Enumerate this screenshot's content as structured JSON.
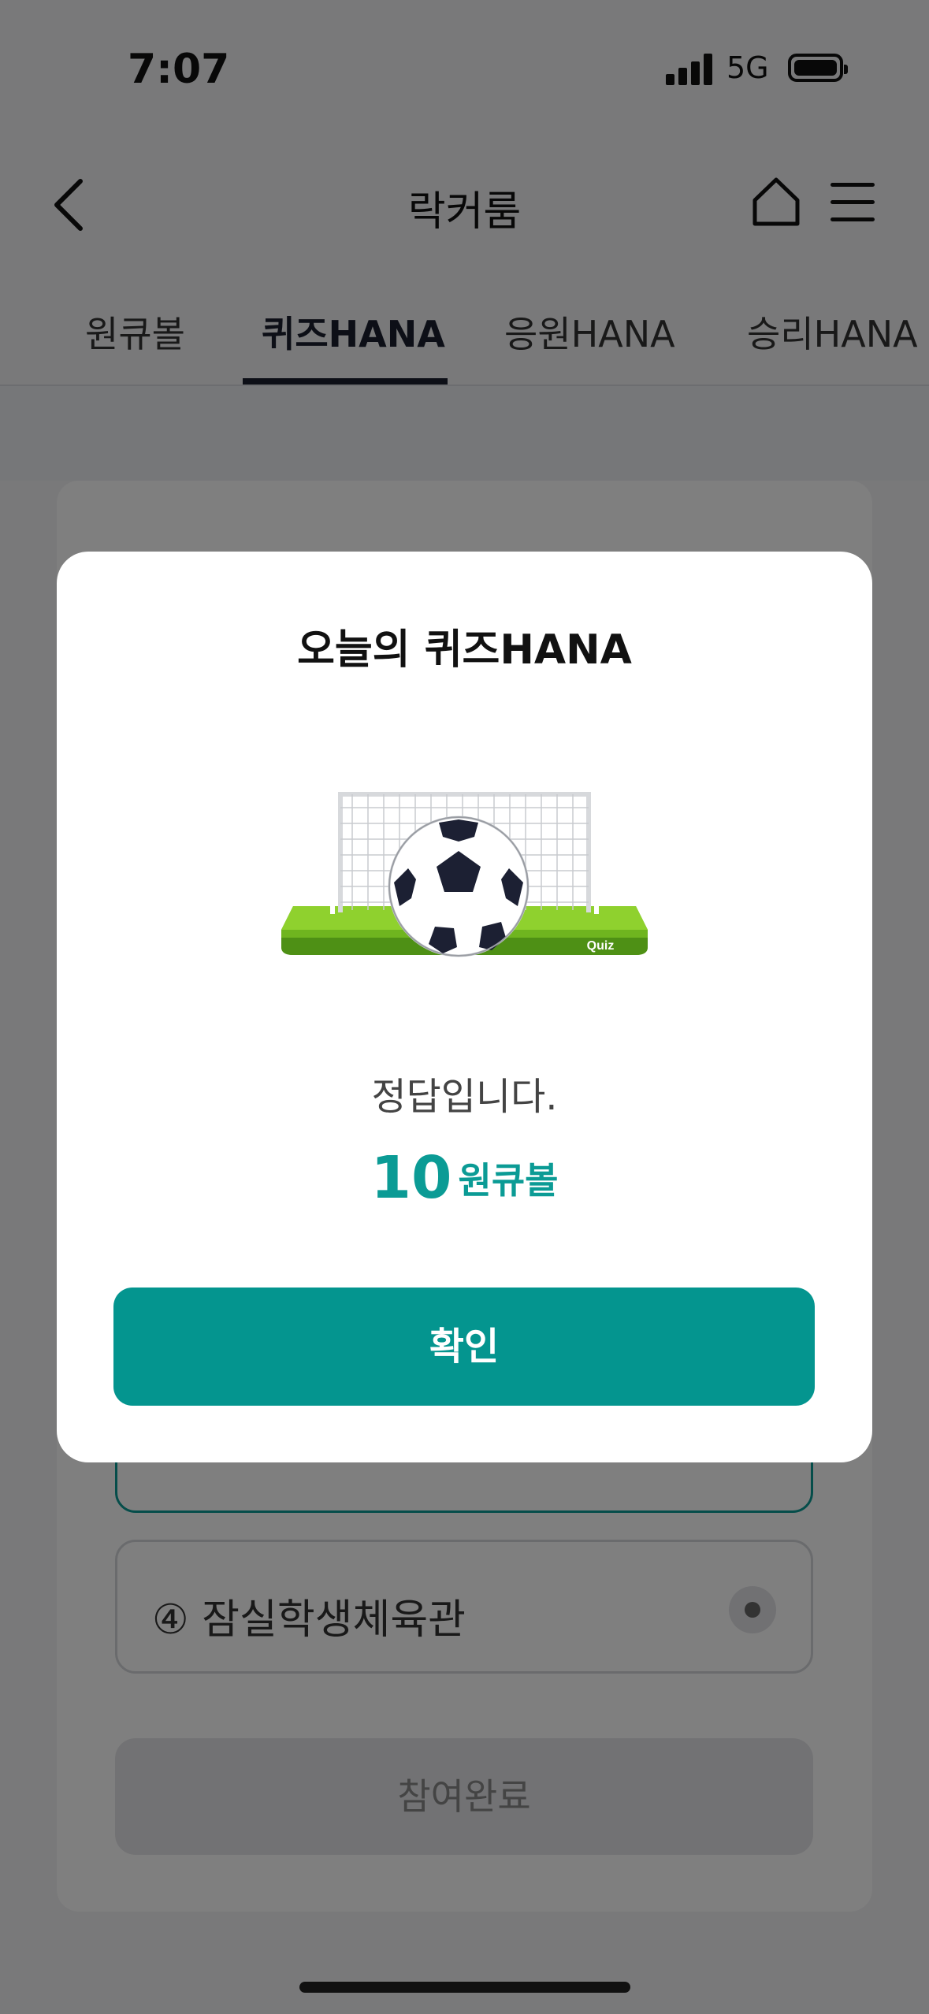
{
  "status_bar": {
    "time": "7:07",
    "network": "5G"
  },
  "header": {
    "title": "락커룸"
  },
  "tabs": [
    {
      "label": "원큐볼",
      "active": false
    },
    {
      "label": "퀴즈HANA",
      "active": true
    },
    {
      "label": "응원HANA",
      "active": false
    },
    {
      "label": "승리HANA",
      "active": false
    }
  ],
  "background_quiz": {
    "options": [
      {
        "label": "④ 잠실학생체육관",
        "selected": false
      }
    ],
    "submit_label": "참여완료"
  },
  "modal": {
    "title": "오늘의 퀴즈HANA",
    "image_caption": "Quiz",
    "result_text": "정답입니다.",
    "reward_amount": "10",
    "reward_unit": "원큐볼",
    "confirm_label": "확인"
  },
  "colors": {
    "accent": "#04958f",
    "tab_active": "#1a1f2e",
    "overlay": "rgba(0,0,0,0.5)"
  }
}
